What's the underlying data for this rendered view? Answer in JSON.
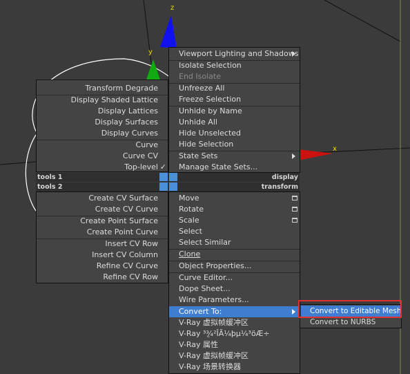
{
  "viewport": {
    "axis_x_label": "x",
    "axis_y_label": "y",
    "axis_z_label": "z",
    "colors": {
      "x_axis": "#cc1111",
      "y_axis": "#11aa11",
      "z_axis": "#1111ee",
      "axis_label": "#f0e000",
      "highlight": "#3f7dd0",
      "callout_border": "#e03030"
    }
  },
  "left_menu": {
    "items": [
      "Transform Degrade",
      "Display Shaded Lattice",
      "Display Lattices",
      "Display Surfaces",
      "Display Curves",
      "Curve",
      "Curve CV",
      "Top-level"
    ],
    "checkmark": "✓",
    "items2": [
      "Create CV Surface",
      "Create CV Curve",
      "Create Point Surface",
      "Create Point Curve",
      "Insert CV Row",
      "Insert CV Column",
      "Refine CV Curve",
      "Refine CV Row"
    ]
  },
  "quad_bars": {
    "tools1_left": "tools 1",
    "tools1_right": "display",
    "tools2_left": "tools 2",
    "tools2_right": "transform"
  },
  "right_menu": {
    "items_top": [
      "Viewport Lighting and Shadows",
      "Isolate Selection",
      "End Isolate",
      "Unfreeze All",
      "Freeze Selection",
      "Unhide by Name",
      "Unhide All",
      "Hide Unselected",
      "Hide Selection",
      "State Sets",
      "Manage State Sets..."
    ],
    "items_bottom": [
      "Move",
      "Rotate",
      "Scale",
      "Select",
      "Select Similar",
      "Clone",
      "Object Properties...",
      "Curve Editor...",
      "Dope Sheet...",
      "Wire Parameters...",
      "Convert To:",
      "V-Ray 虚拟帧缓冲区",
      "V-Ray ³ֲ¾²ÎÃ¼þµ¼³öÆ÷",
      "V-Ray 属性",
      "V-Ray 虚拟帧缓冲区",
      "V-Ray 场景转换器"
    ]
  },
  "submenu": {
    "items": [
      "Convert to Editable Mesh",
      "Convert to NURBS"
    ]
  }
}
